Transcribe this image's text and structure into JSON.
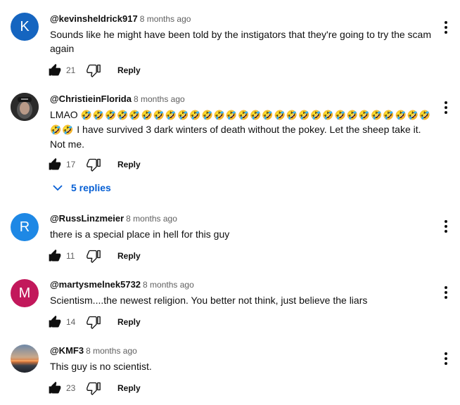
{
  "comments": [
    {
      "author": "@kevinsheldrick917",
      "time": "8 months ago",
      "text": "Sounds like he might have been told by the instigators that they're going to try the scam again",
      "likes": "21",
      "reply_label": "Reply",
      "avatar_letter": "K",
      "avatar_color": "#1565c0"
    },
    {
      "author": "@ChristieinFlorida",
      "time": "8 months ago",
      "text_prefix": "LMAO",
      "emoji": "🤣",
      "emoji_count": 31,
      "text_suffix": "I have survived 3 dark winters of death without the pokey. Let the sheep take it. Not me.",
      "likes": "17",
      "reply_label": "Reply",
      "replies_label": "5 replies"
    },
    {
      "author": "@RussLinzmeier",
      "time": "8 months ago",
      "text": "there is a special place in hell for this guy",
      "likes": "11",
      "reply_label": "Reply",
      "avatar_letter": "R",
      "avatar_color": "#1e88e5"
    },
    {
      "author": "@martysmelnek5732",
      "time": "8 months ago",
      "text": "Scientism....the newest religion. You better not think, just believe the liars",
      "likes": "14",
      "reply_label": "Reply",
      "avatar_letter": "M",
      "avatar_color": "#c2185b"
    },
    {
      "author": "@KMF3",
      "time": "8 months ago",
      "text": "This guy is no scientist.",
      "likes": "23",
      "reply_label": "Reply"
    }
  ],
  "icons": {
    "like": "thumbs-up-icon",
    "dislike": "thumbs-down-icon",
    "menu": "more-vertical-icon",
    "chevron": "chevron-down-icon"
  },
  "colors": {
    "link_blue": "#065fd4",
    "muted_text": "#606060"
  }
}
